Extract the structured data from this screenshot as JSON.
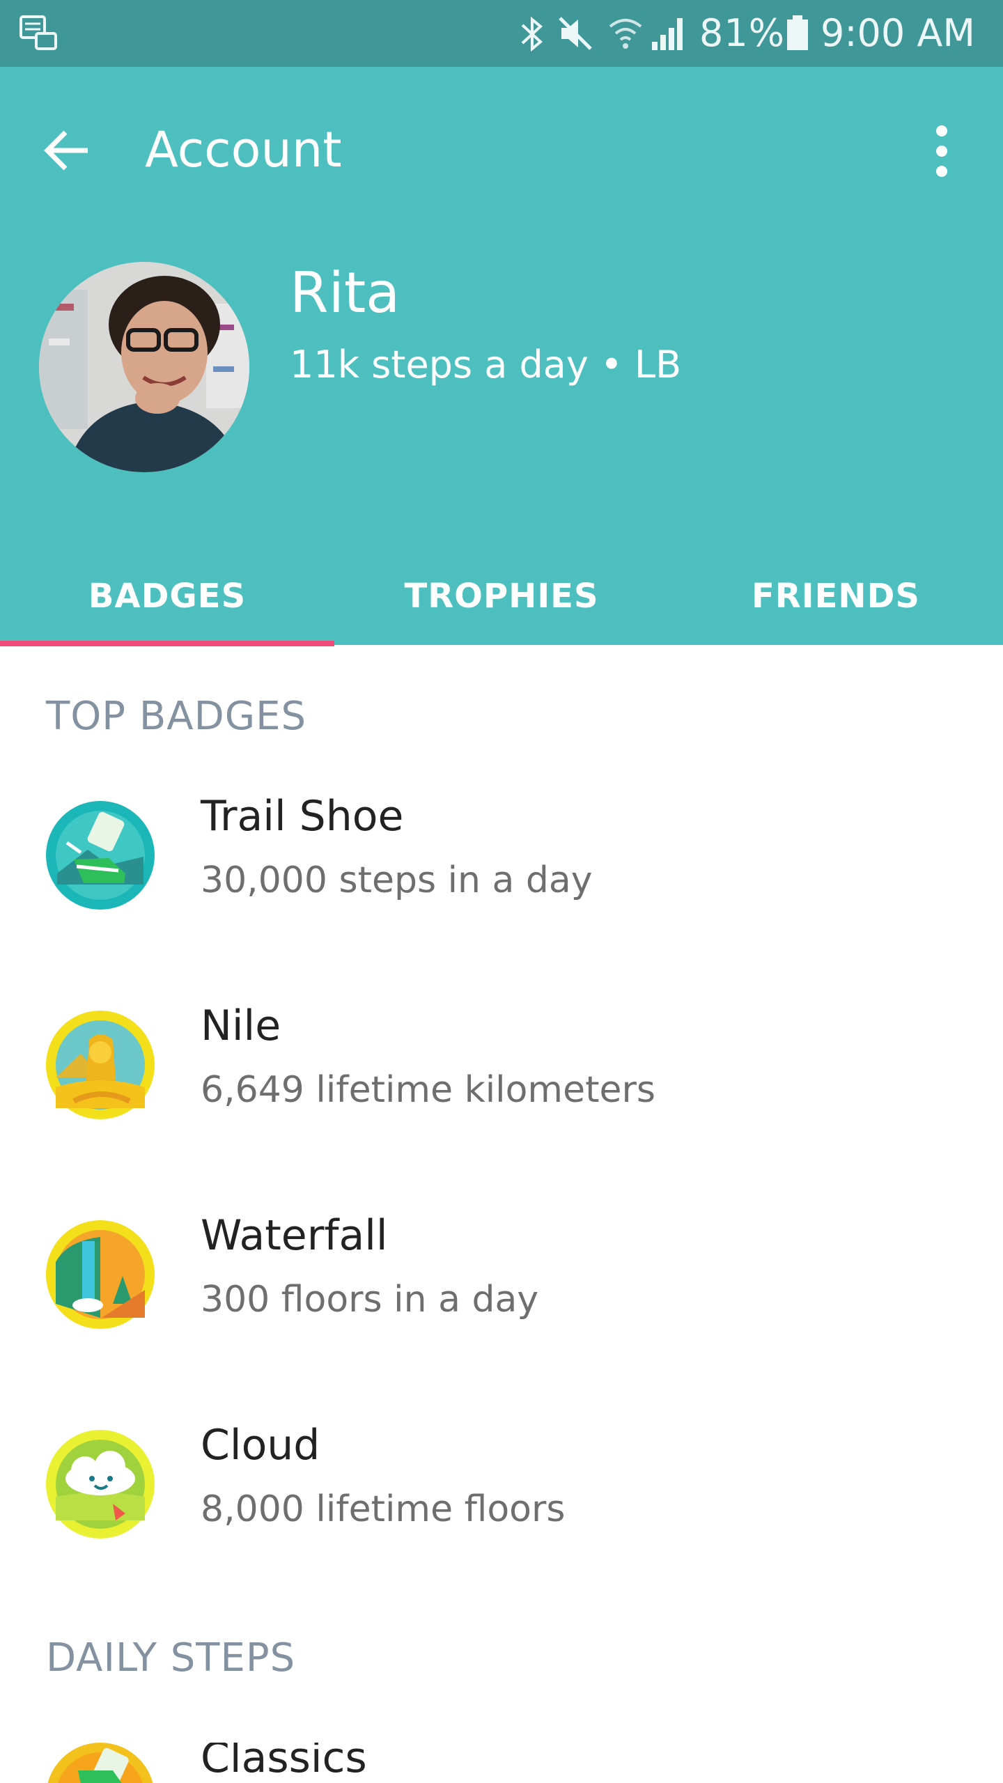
{
  "status_bar": {
    "battery": "81%",
    "time": "9:00 AM",
    "icons": [
      "notification-icon",
      "bluetooth-icon",
      "mute-icon",
      "wifi-icon",
      "signal-icon",
      "battery-icon"
    ]
  },
  "header": {
    "title": "Account",
    "back_icon": "arrow-left-icon",
    "menu_icon": "more-vert-icon"
  },
  "profile": {
    "name": "Rita",
    "subtitle": "11k steps a day • LB"
  },
  "tabs": [
    {
      "label": "BADGES",
      "active": true
    },
    {
      "label": "TROPHIES",
      "active": false
    },
    {
      "label": "FRIENDS",
      "active": false
    }
  ],
  "sections": {
    "top_badges": {
      "title": "TOP BADGES",
      "items": [
        {
          "name": "Trail Shoe",
          "desc": "30,000 steps in a day",
          "icon": "trail-shoe-badge-icon"
        },
        {
          "name": "Nile",
          "desc": "6,649 lifetime kilometers",
          "icon": "nile-badge-icon"
        },
        {
          "name": "Waterfall",
          "desc": "300 floors in a day",
          "icon": "waterfall-badge-icon"
        },
        {
          "name": "Cloud",
          "desc": "8,000 lifetime floors",
          "icon": "cloud-badge-icon"
        }
      ]
    },
    "daily_steps": {
      "title": "DAILY STEPS",
      "items": [
        {
          "name": "Classics",
          "icon": "classics-badge-icon"
        }
      ]
    }
  },
  "colors": {
    "status_bar": "#409798",
    "header": "#4ebfbf",
    "tab_indicator": "#f04a79",
    "section_title": "#8391a0"
  }
}
